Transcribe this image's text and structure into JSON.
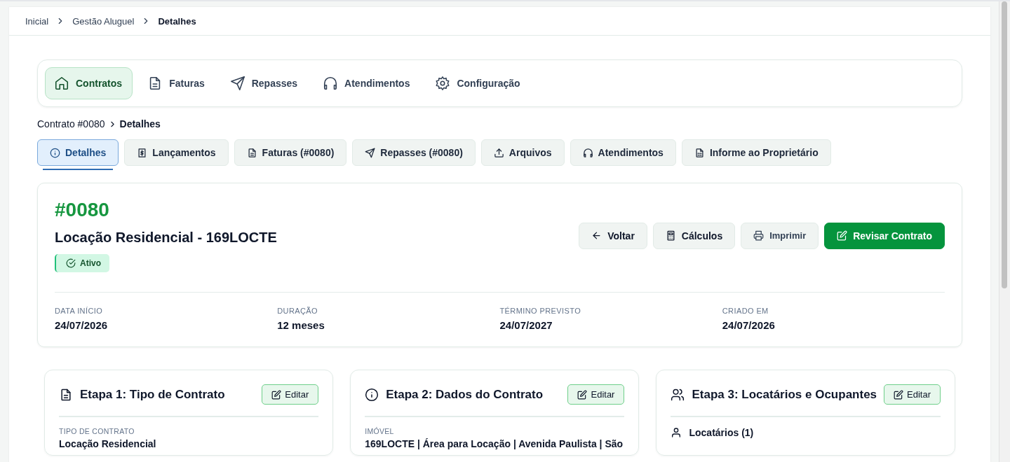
{
  "breadcrumb": [
    {
      "label": "Inicial",
      "current": false
    },
    {
      "label": "Gestão Aluguel",
      "current": false
    },
    {
      "label": "Detalhes",
      "current": true
    }
  ],
  "nav": [
    {
      "label": "Contratos",
      "selected": true
    },
    {
      "label": "Faturas",
      "selected": false
    },
    {
      "label": "Repasses",
      "selected": false
    },
    {
      "label": "Atendimentos",
      "selected": false
    },
    {
      "label": "Configuração",
      "selected": false
    }
  ],
  "sub_breadcrumb": [
    {
      "label": "Contrato #0080",
      "current": false
    },
    {
      "label": "Detalhes",
      "current": true
    }
  ],
  "tabs": [
    {
      "label": "Detalhes",
      "selected": true
    },
    {
      "label": "Lançamentos",
      "selected": false
    },
    {
      "label": "Faturas (#0080)",
      "selected": false
    },
    {
      "label": "Repasses (#0080)",
      "selected": false
    },
    {
      "label": "Arquivos",
      "selected": false
    },
    {
      "label": "Atendimentos",
      "selected": false
    },
    {
      "label": "Informe ao Proprietário",
      "selected": false
    }
  ],
  "contract": {
    "number": "#0080",
    "title": "Locação Residencial - 169LOCTE",
    "status": {
      "label": "Ativo",
      "kind": "active"
    },
    "actions": [
      {
        "label": "Voltar",
        "kind": "secondary"
      },
      {
        "label": "Cálculos",
        "kind": "secondary"
      },
      {
        "label": "Imprimir",
        "kind": "muted"
      },
      {
        "label": "Revisar Contrato",
        "kind": "primary"
      }
    ],
    "fields": [
      {
        "label": "DATA INÍCIO",
        "value": "24/07/2026"
      },
      {
        "label": "DURAÇÃO",
        "value": "12 meses"
      },
      {
        "label": "TÉRMINO PREVISTO",
        "value": "24/07/2027"
      },
      {
        "label": "CRIADO EM",
        "value": "24/07/2026"
      }
    ]
  },
  "steps": [
    {
      "title": "Etapa 1: Tipo de Contrato",
      "button": "Editar",
      "content": {
        "kind": "field",
        "label": "TIPO DE CONTRATO",
        "value": "Locação Residencial"
      }
    },
    {
      "title": "Etapa 2: Dados do Contrato",
      "button": "Editar",
      "content": {
        "kind": "field",
        "label": "IMÓVEL",
        "value": "169LOCTE | Área para Locação | Avenida Paulista | São"
      }
    },
    {
      "title": "Etapa 3: Locatários e Ocupantes",
      "button": "Editar",
      "content": {
        "kind": "section",
        "label": "Locatários (1)"
      }
    }
  ]
}
